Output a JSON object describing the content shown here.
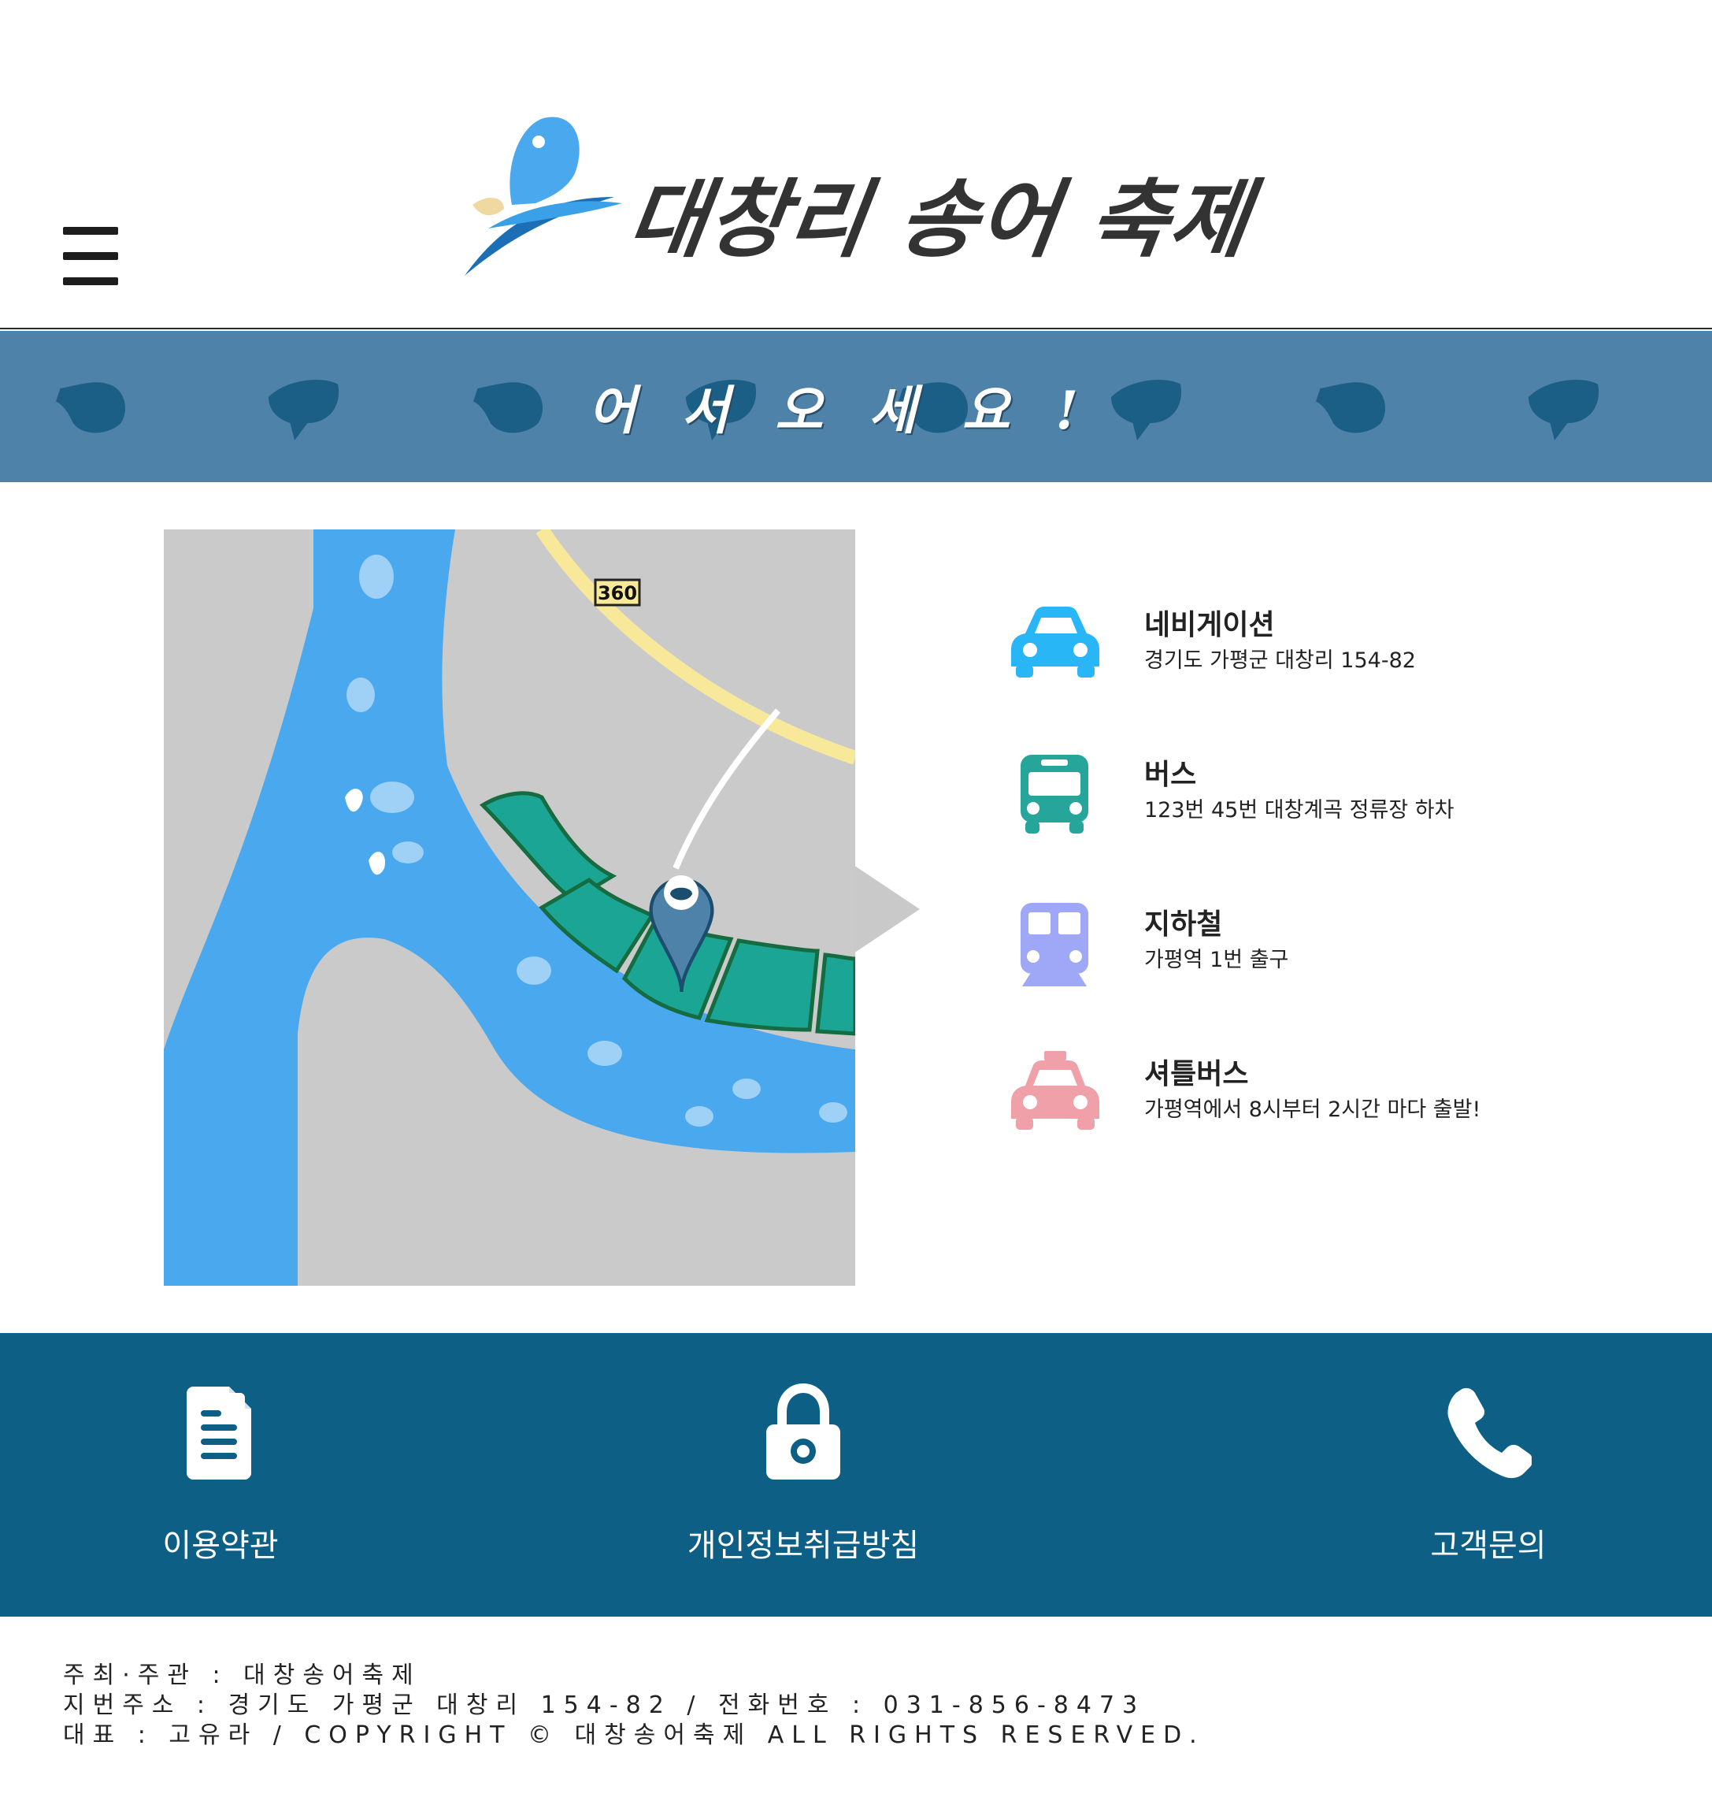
{
  "header": {
    "menu_icon": "hamburger-menu-icon",
    "logo_text": "대창리 송어 축제",
    "logo_icon": "fish-logo-icon"
  },
  "banner": {
    "title": "어서오세요!",
    "decoration_icon": "fish-silhouette-icon",
    "bg_color": "#4f82a8"
  },
  "map": {
    "road_number": "360",
    "marker_icon": "location-pin-icon"
  },
  "transport": [
    {
      "icon": "car-icon",
      "color": "#29b6f6",
      "title": "네비게이션",
      "desc": "경기도 가평군 대창리 154-82"
    },
    {
      "icon": "bus-icon",
      "color": "#26a69a",
      "title": "버스",
      "desc": "123번 45번 대창계곡 정류장 하차"
    },
    {
      "icon": "subway-icon",
      "color": "#9fa8f7",
      "title": "지하철",
      "desc": "가평역 1번 출구"
    },
    {
      "icon": "shuttle-taxi-icon",
      "color": "#f0a0a8",
      "title": "셔틀버스",
      "desc": "가평역에서 8시부터 2시간 마다 출발!"
    }
  ],
  "footer_nav": {
    "bg_color": "#0e5f85",
    "items": [
      {
        "icon": "document-icon",
        "label": "이용약관"
      },
      {
        "icon": "lock-icon",
        "label": "개인정보취급방침"
      },
      {
        "icon": "phone-icon",
        "label": "고객문의"
      }
    ]
  },
  "info": {
    "line1": "주최·주관 : 대창송어축제",
    "line2": "지번주소 : 경기도 가평군 대창리 154-82 / 전화번호 : 031-856-8473",
    "line3": "대표 : 고유라 / COPYRIGHT © 대창송어축제 ALL RIGHTS RESERVED."
  }
}
